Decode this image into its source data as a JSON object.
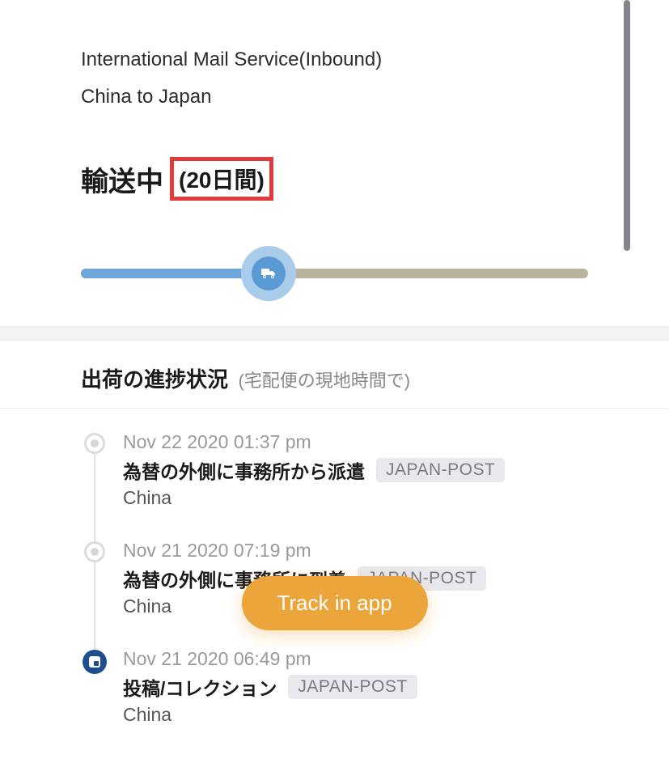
{
  "header": {
    "service": "International Mail Service(Inbound)",
    "route": "China to Japan"
  },
  "status": {
    "label": "輸送中",
    "duration": "(20日間)",
    "progress_percent": 37
  },
  "progress_icon": "truck-icon",
  "section": {
    "title": "出荷の進捗状況",
    "subtitle": "(宅配便の現地時間で)"
  },
  "events": [
    {
      "date": "Nov 22 2020 01:37 pm",
      "description": "為替の外側に事務所から派遣",
      "carrier": "JAPAN-POST",
      "location": "China",
      "origin": false
    },
    {
      "date": "Nov 21 2020 07:19 pm",
      "description": "為替の外側に事務所に到着",
      "carrier": "JAPAN-POST",
      "location": "China",
      "origin": false
    },
    {
      "date": "Nov 21 2020 06:49 pm",
      "description": "投稿/コレクション",
      "carrier": "JAPAN-POST",
      "location": "China",
      "origin": true
    }
  ],
  "cta": {
    "track_app": "Track in app"
  }
}
